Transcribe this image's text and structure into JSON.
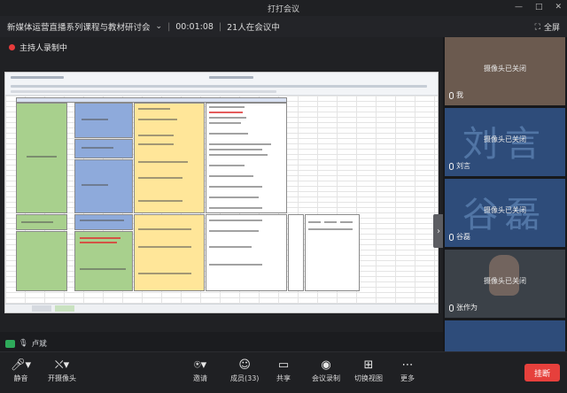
{
  "window": {
    "title": "打打会议",
    "min": "—",
    "max": "□",
    "close": "✕"
  },
  "meeting": {
    "topic": "新媒体运营直播系列课程与教材研讨会",
    "elapsed": "00:01:08",
    "attendees": "21人在会议中",
    "fullscreen_label": "全屏"
  },
  "recording": {
    "label": "主持人录制中"
  },
  "speaker": {
    "name": "卢斌"
  },
  "participants": [
    {
      "name": "我",
      "big_text": "",
      "status": "摄像头已关闭",
      "tint": "#6b5a4f"
    },
    {
      "name": "刘言",
      "big_text": "刘言",
      "status": "摄像头已关闭",
      "tint": "#2e4c7a"
    },
    {
      "name": "谷磊",
      "big_text": "谷磊",
      "status": "摄像头已关闭",
      "tint": "#2e4c7a"
    },
    {
      "name": "张作为",
      "big_text": "",
      "status": "摄像头已关闭",
      "tint": "#3b4148"
    },
    {
      "name": "",
      "big_text": "",
      "status": "",
      "tint": "#2e4c7a"
    }
  ],
  "toolbar": {
    "mute": "静音",
    "camera": "开摄像头",
    "invite": "邀请",
    "members": "成员(33)",
    "share": "共享",
    "record": "会议录制",
    "switch_view": "切换视图",
    "more": "更多",
    "leave": "挂断"
  },
  "colors": {
    "accent": "#e6403c",
    "green": "#2eaa5a",
    "sheet_green": "#a8d08d",
    "sheet_blue": "#8eaadb",
    "sheet_yellow": "#ffe699"
  }
}
